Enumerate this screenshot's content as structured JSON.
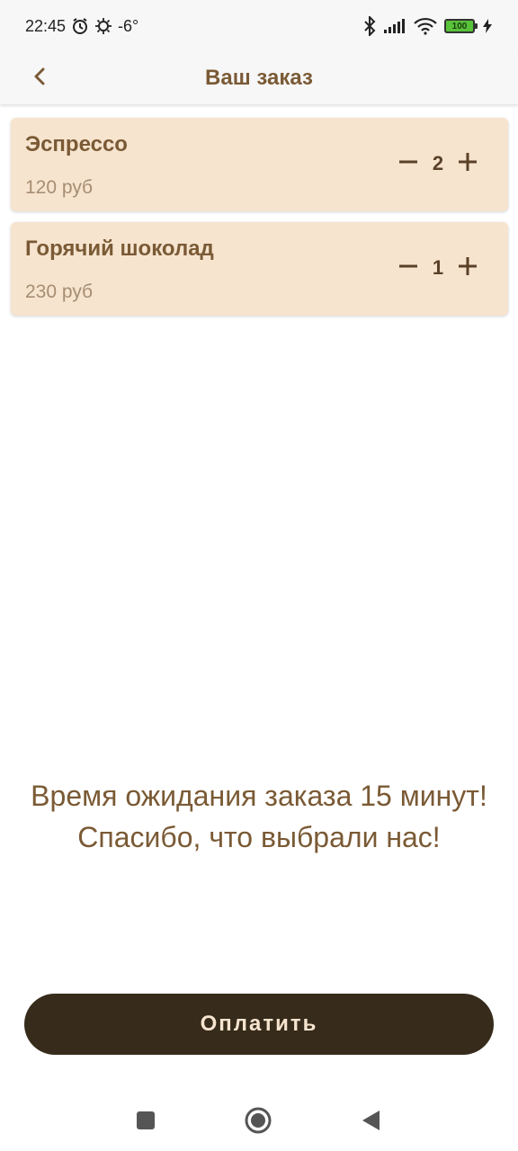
{
  "status_bar": {
    "time": "22:45",
    "temperature": "-6°",
    "battery": "100",
    "icons": [
      "alarm-icon",
      "weather-icon",
      "bluetooth-icon",
      "signal-icon",
      "wifi-icon",
      "battery-icon",
      "charging-icon"
    ]
  },
  "header": {
    "title": "Ваш заказ",
    "back_icon": "chevron-left-icon"
  },
  "order": {
    "items": [
      {
        "name": "Эспрессо",
        "price": "120 руб",
        "quantity": "2"
      },
      {
        "name": "Горячий шоколад",
        "price": "230 руб",
        "quantity": "1"
      }
    ]
  },
  "message": {
    "line1": "Время ожидания заказа 15 минут!",
    "line2": "Спасибо, что выбрали нас!"
  },
  "pay_button": {
    "label": "Оплатить"
  },
  "nav": {
    "icons": [
      "recents-icon",
      "home-icon",
      "back-icon"
    ]
  },
  "colors": {
    "accent": "#7a5a35",
    "card_bg": "#f6e4cf",
    "price": "#a78d72",
    "button_bg": "#372b1b",
    "button_text": "#f6e4cf"
  }
}
